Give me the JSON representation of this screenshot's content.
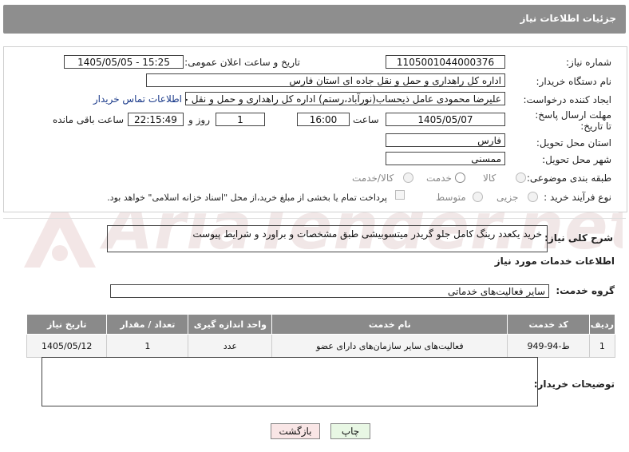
{
  "header": {
    "title": "جزئیات اطلاعات نیاز"
  },
  "watermark": {
    "text": "AriaTender.net"
  },
  "form": {
    "need_number": {
      "label": "شماره نیاز:",
      "value": "1105001044000376"
    },
    "announce_datetime": {
      "label": "تاریخ و ساعت اعلان عمومی:",
      "value": "1405/05/05 - 15:25"
    },
    "buyer_org": {
      "label": "نام دستگاه خریدار:",
      "value": "اداره کل راهداری و حمل و نقل جاده ای استان فارس"
    },
    "requester": {
      "label": "ایجاد کننده درخواست:",
      "value": "علیرضا محمودی عامل ذیحساب(نورآباد،رستم) اداره کل راهداری و حمل و نقل جا",
      "contact_link": "اطلاعات تماس خریدار"
    },
    "deadline": {
      "label": "مهلت ارسال پاسخ: تا تاریخ:",
      "date": "1405/05/07",
      "time_label": "ساعت",
      "time": "16:00",
      "days": "1",
      "days_label": "روز و",
      "remaining": "22:15:49",
      "remaining_label": "ساعت باقی مانده"
    },
    "province": {
      "label": "استان محل تحویل:",
      "value": "فارس"
    },
    "city": {
      "label": "شهر محل تحویل:",
      "value": "ممسنی"
    },
    "category": {
      "label": "طبقه بندی موضوعی:",
      "options": [
        "کالا",
        "خدمت",
        "کالا/خدمت"
      ],
      "selected": "خدمت"
    },
    "purchase_type": {
      "label": "نوع فرآیند خرید :",
      "options": [
        "جزیی",
        "متوسط"
      ],
      "selected": "",
      "note": "پرداخت تمام یا بخشی از مبلغ خرید،از محل \"اسناد خزانه اسلامی\" خواهد بود."
    }
  },
  "description": {
    "label": "شرح کلی نیاز:",
    "value": "خرید یکعدد رینگ کامل جلو گریدر میتسوبیشی طبق مشخصات و براورد و شرایط پیوست"
  },
  "services_title": "اطلاعات خدمات مورد نیاز",
  "service_group": {
    "label": "گروه خدمت:",
    "value": "سایر فعالیت‌های خدماتی"
  },
  "table": {
    "headers": [
      "ردیف",
      "کد خدمت",
      "نام خدمت",
      "واحد اندازه گیری",
      "تعداد / مقدار",
      "تاریخ نیاز"
    ],
    "rows": [
      [
        "1",
        "ط-94-949",
        "فعالیت‌های سایر سازمان‌های دارای عضو",
        "عدد",
        "1",
        "1405/05/12"
      ]
    ]
  },
  "buyer_notes": {
    "label": "توضیحات خریدار:",
    "value": ""
  },
  "buttons": {
    "print": "چاپ",
    "back": "بازگشت"
  },
  "colors": {
    "header_bg": "#8e8e8e",
    "print_bg": "#e8f7e4",
    "back_bg": "#f9e6e6",
    "link": "#1a3a8a"
  }
}
